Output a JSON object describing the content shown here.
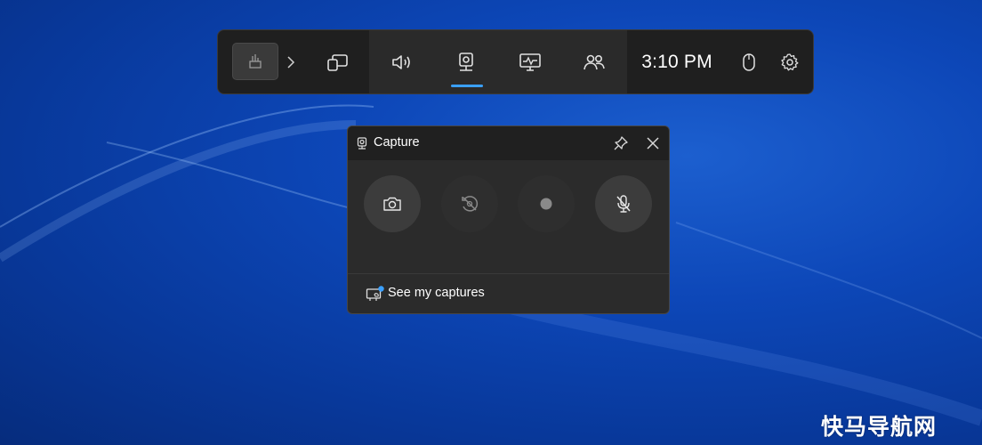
{
  "colors": {
    "accent": "#3aa0ff",
    "bar_bg": "#1f1f1f",
    "panel_bg": "#2b2b2b",
    "desktop_blue": "#0d47b8"
  },
  "gamebar": {
    "clock": "3:10 PM",
    "widgets": [
      {
        "name": "widget-tile",
        "icon": "game-tile-icon"
      },
      {
        "name": "expand",
        "icon": "chevron-right-icon"
      },
      {
        "name": "widget-store",
        "icon": "widget-store-icon"
      },
      {
        "name": "audio",
        "icon": "speaker-icon"
      },
      {
        "name": "capture",
        "icon": "webcam-icon",
        "active": true
      },
      {
        "name": "performance",
        "icon": "monitor-pulse-icon"
      },
      {
        "name": "social",
        "icon": "people-icon"
      },
      {
        "name": "mouse",
        "icon": "mouse-icon"
      },
      {
        "name": "settings",
        "icon": "gear-icon"
      }
    ]
  },
  "capture_panel": {
    "title": "Capture",
    "buttons": [
      {
        "name": "screenshot",
        "icon": "camera-icon",
        "enabled": true
      },
      {
        "name": "record-last-30s",
        "icon": "rewind-disabled-icon",
        "enabled": false
      },
      {
        "name": "start-recording",
        "icon": "record-dot-icon",
        "enabled": false
      },
      {
        "name": "microphone",
        "icon": "mic-muted-icon",
        "enabled": true
      }
    ],
    "footer": {
      "label": "See my captures",
      "icon": "gallery-notification-icon"
    }
  },
  "watermark": "快马导航网"
}
